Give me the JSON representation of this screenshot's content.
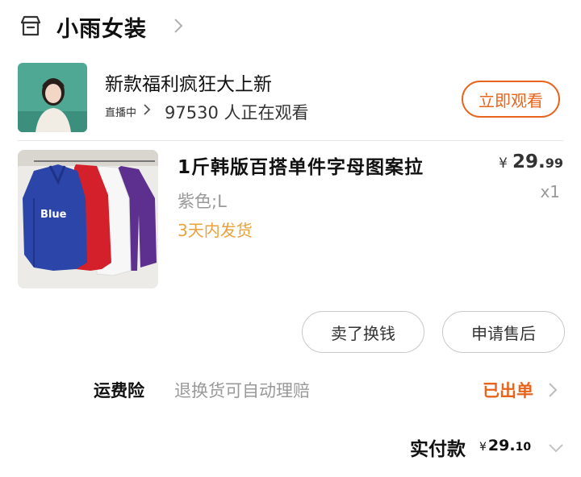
{
  "shop": {
    "name": "小雨女装",
    "icon": "store-icon"
  },
  "live": {
    "title": "新款福利疯狂大上新",
    "status": "直播中",
    "viewer_count": "97530",
    "viewer_suffix": "人正在观看",
    "watch_button": "立即观看"
  },
  "product": {
    "title": "1斤韩版百搭单件字母图案拉",
    "variant": "紫色;L",
    "shipping": "3天内发货",
    "currency": "¥",
    "price_int": "29.",
    "price_dec": "99",
    "quantity": "x1",
    "image_text": "Blue"
  },
  "actions": {
    "sell_button": "卖了换钱",
    "after_sales_button": "申请售后"
  },
  "insurance": {
    "label": "运费险",
    "desc": "退换货可自动理赔",
    "status": "已出单"
  },
  "payment": {
    "label": "实付款",
    "currency": "¥",
    "amount_int": "29.",
    "amount_dec": "10"
  },
  "colors": {
    "accent": "#e8641d",
    "shipping": "#e9a23b",
    "muted": "#999999"
  }
}
